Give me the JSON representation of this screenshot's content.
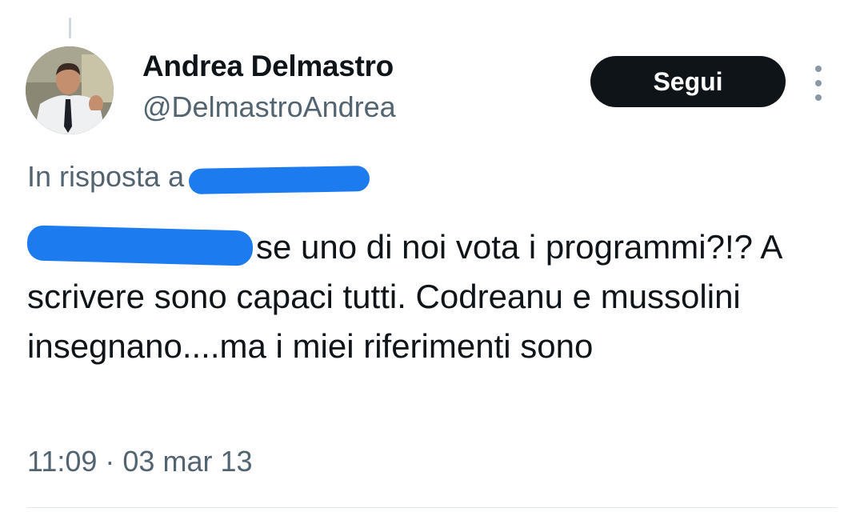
{
  "tweet": {
    "author": {
      "display_name": "Andrea Delmastro",
      "handle": "@DelmastroAndrea",
      "avatar_icon": "profile-photo"
    },
    "follow_label": "Segui",
    "more_icon": "vertical-ellipsis-icon",
    "reply_prefix": "In risposta a",
    "body_text": "se uno di noi vota i programmi?!? A scrivere sono capaci tutti. Codreanu e mussolini insegnano....ma i miei riferimenti sono",
    "timestamp": "11:09 · 03 mar 13"
  },
  "colors": {
    "follow_button_bg": "#0f1419",
    "redaction": "#1d7bf0",
    "secondary_text": "#536471"
  }
}
